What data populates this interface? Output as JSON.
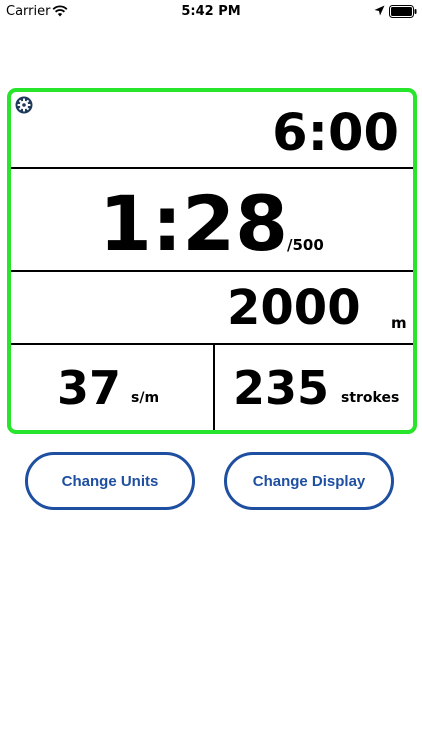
{
  "status_bar": {
    "carrier": "Carrier",
    "time": "5:42 PM",
    "icons": [
      "wifi-icon",
      "location-icon",
      "battery-icon"
    ]
  },
  "monitor": {
    "border_color": "#27e52a",
    "settings_icon": "gear-icon",
    "elapsed_time": "6:00",
    "pace": "1:28",
    "pace_unit": "/500",
    "distance": "2000",
    "distance_unit": "m",
    "stroke_rate": "37",
    "stroke_rate_unit": "s/m",
    "stroke_count": "235",
    "stroke_count_unit": "strokes"
  },
  "buttons": {
    "change_units": "Change Units",
    "change_display": "Change Display",
    "accent_color": "#1e4fa0"
  }
}
